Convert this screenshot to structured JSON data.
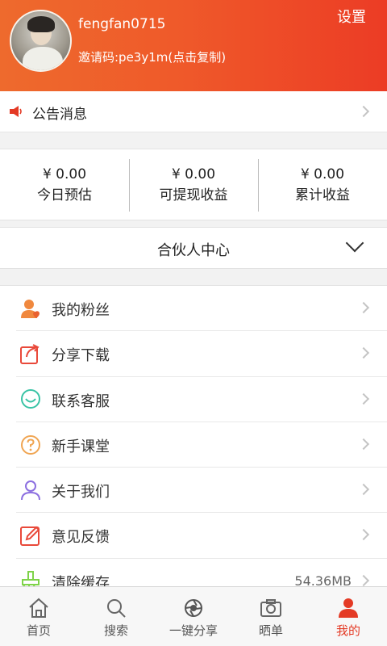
{
  "header": {
    "username": "fengfan0715",
    "invite_text": "邀请码:pe3y1m(点击复制)",
    "settings_label": "设置"
  },
  "notice": {
    "label": "公告消息"
  },
  "earnings": [
    {
      "amount": "¥ 0.00",
      "label": "今日预估"
    },
    {
      "amount": "¥ 0.00",
      "label": "可提现收益"
    },
    {
      "amount": "¥ 0.00",
      "label": "累计收益"
    }
  ],
  "partner": {
    "label": "合伙人中心"
  },
  "menu": {
    "fans": "我的粉丝",
    "share": "分享下载",
    "service": "联系客服",
    "class": "新手课堂",
    "about": "关于我们",
    "feedback": "意见反馈",
    "cache": "清除缓存",
    "cache_size": "54.36MB"
  },
  "tabs": {
    "home": "首页",
    "search": "搜索",
    "share": "一键分享",
    "post": "晒单",
    "mine": "我的"
  },
  "colors": {
    "accent": "#e43a25",
    "header_start": "#ee6a2d",
    "header_end": "#ec3c25"
  }
}
